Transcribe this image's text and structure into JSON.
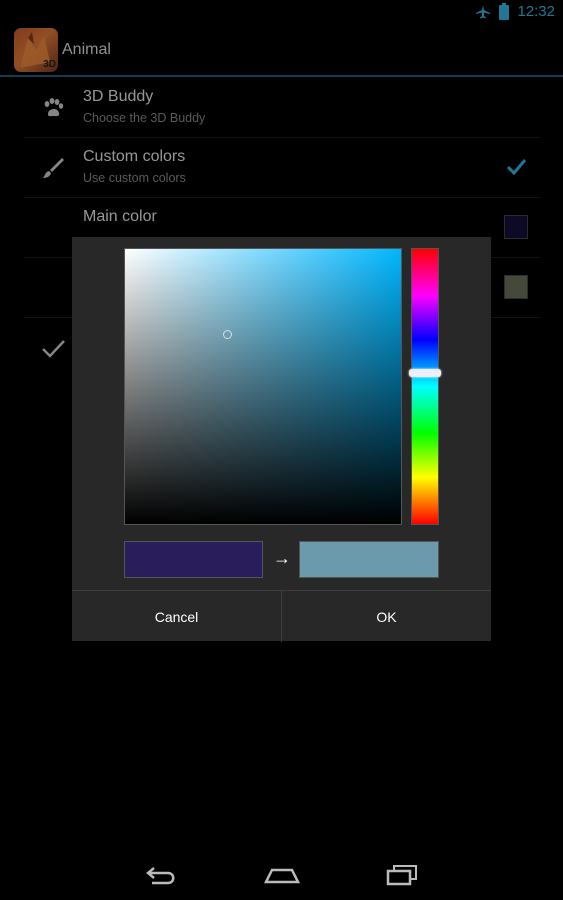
{
  "status_bar": {
    "time": "12:32",
    "icons": [
      "airplane-icon",
      "battery-icon"
    ]
  },
  "action_bar": {
    "title": "Animal",
    "app_badge": "3D"
  },
  "preferences": [
    {
      "title": "3D Buddy",
      "summary": "Choose the 3D Buddy",
      "icon": "paw-icon"
    },
    {
      "title": "Custom colors",
      "summary": "Use custom colors",
      "icon": "brush-icon",
      "checked": true
    },
    {
      "title": "Main color",
      "summary": "",
      "swatch": "#14103a"
    },
    {
      "title": "",
      "summary": "",
      "swatch": "#6a705a"
    },
    {
      "title": "",
      "summary": "",
      "icon": "check-icon"
    }
  ],
  "color_picker": {
    "hue_color": "#00b6ff",
    "old_color": "#2a1d5c",
    "new_color": "#6a9aac",
    "arrow": "→",
    "cancel_label": "Cancel",
    "ok_label": "OK"
  },
  "colors": {
    "accent": "#33b5e5",
    "divider": "#1f5f7a"
  },
  "nav_bar": {
    "icons": [
      "back-icon",
      "home-icon",
      "recents-icon"
    ]
  }
}
